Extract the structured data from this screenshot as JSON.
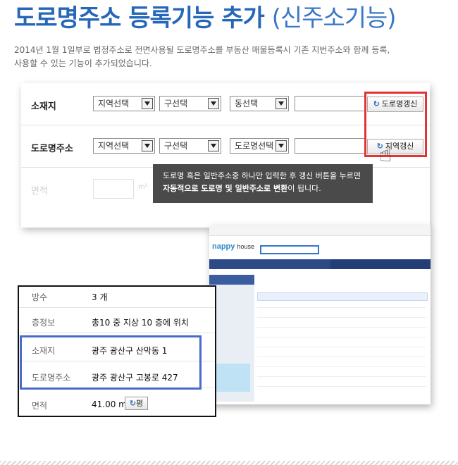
{
  "header": {
    "title_bold": "도로명주소 등록기능 추가",
    "title_light": "(신주소기능)",
    "desc_line1": "2014년 1월 1일부로 법정주소로 전면사용될 도로명주소를 부동산 매물등록시 기존 지번주소와 함께 등록,",
    "desc_line2": "사용할 수 있는 기능이 추가되었습니다."
  },
  "form": {
    "row1": {
      "label": "소재지",
      "select1": "지역선택",
      "select2": "구선택",
      "select3": "동선택",
      "button": "도로명갱신"
    },
    "row2": {
      "label": "도로명주소",
      "select1": "지역선택",
      "select2": "구선택",
      "select3": "도로명선택",
      "button": "지역갱신"
    },
    "row3": {
      "label": "면적",
      "unit": "m²"
    }
  },
  "tooltip": {
    "line1": "도로명 혹은 일반주소중 하나만 입력한 후 갱신 버튼을 누르면",
    "line2_bold": "자동적으로 도로명 및 일반주소로 변환",
    "line2_rest": "이 됩니다."
  },
  "website": {
    "logo_main": "nappy",
    "logo_sub": "house"
  },
  "detail": {
    "rows": [
      {
        "key": "방수",
        "value": "3 개"
      },
      {
        "key": "층정보",
        "value": "총10 중 지상 10 층에 위치"
      },
      {
        "key": "소재지",
        "value": "광주 광산구 산막동 1"
      },
      {
        "key": "도로명주소",
        "value": "광주 광산구 고봉로 427"
      },
      {
        "key": "면적",
        "value": "41.00 m²"
      }
    ],
    "area_button": "평"
  },
  "icons": {
    "refresh": "refresh-icon",
    "hand": "hand-pointer-icon",
    "dropdown": "chevron-down-icon"
  },
  "colors": {
    "title": "#2667b8",
    "highlight_red": "#e23434",
    "highlight_blue": "#4a6bc8",
    "tooltip_bg": "#4a4a4a"
  }
}
